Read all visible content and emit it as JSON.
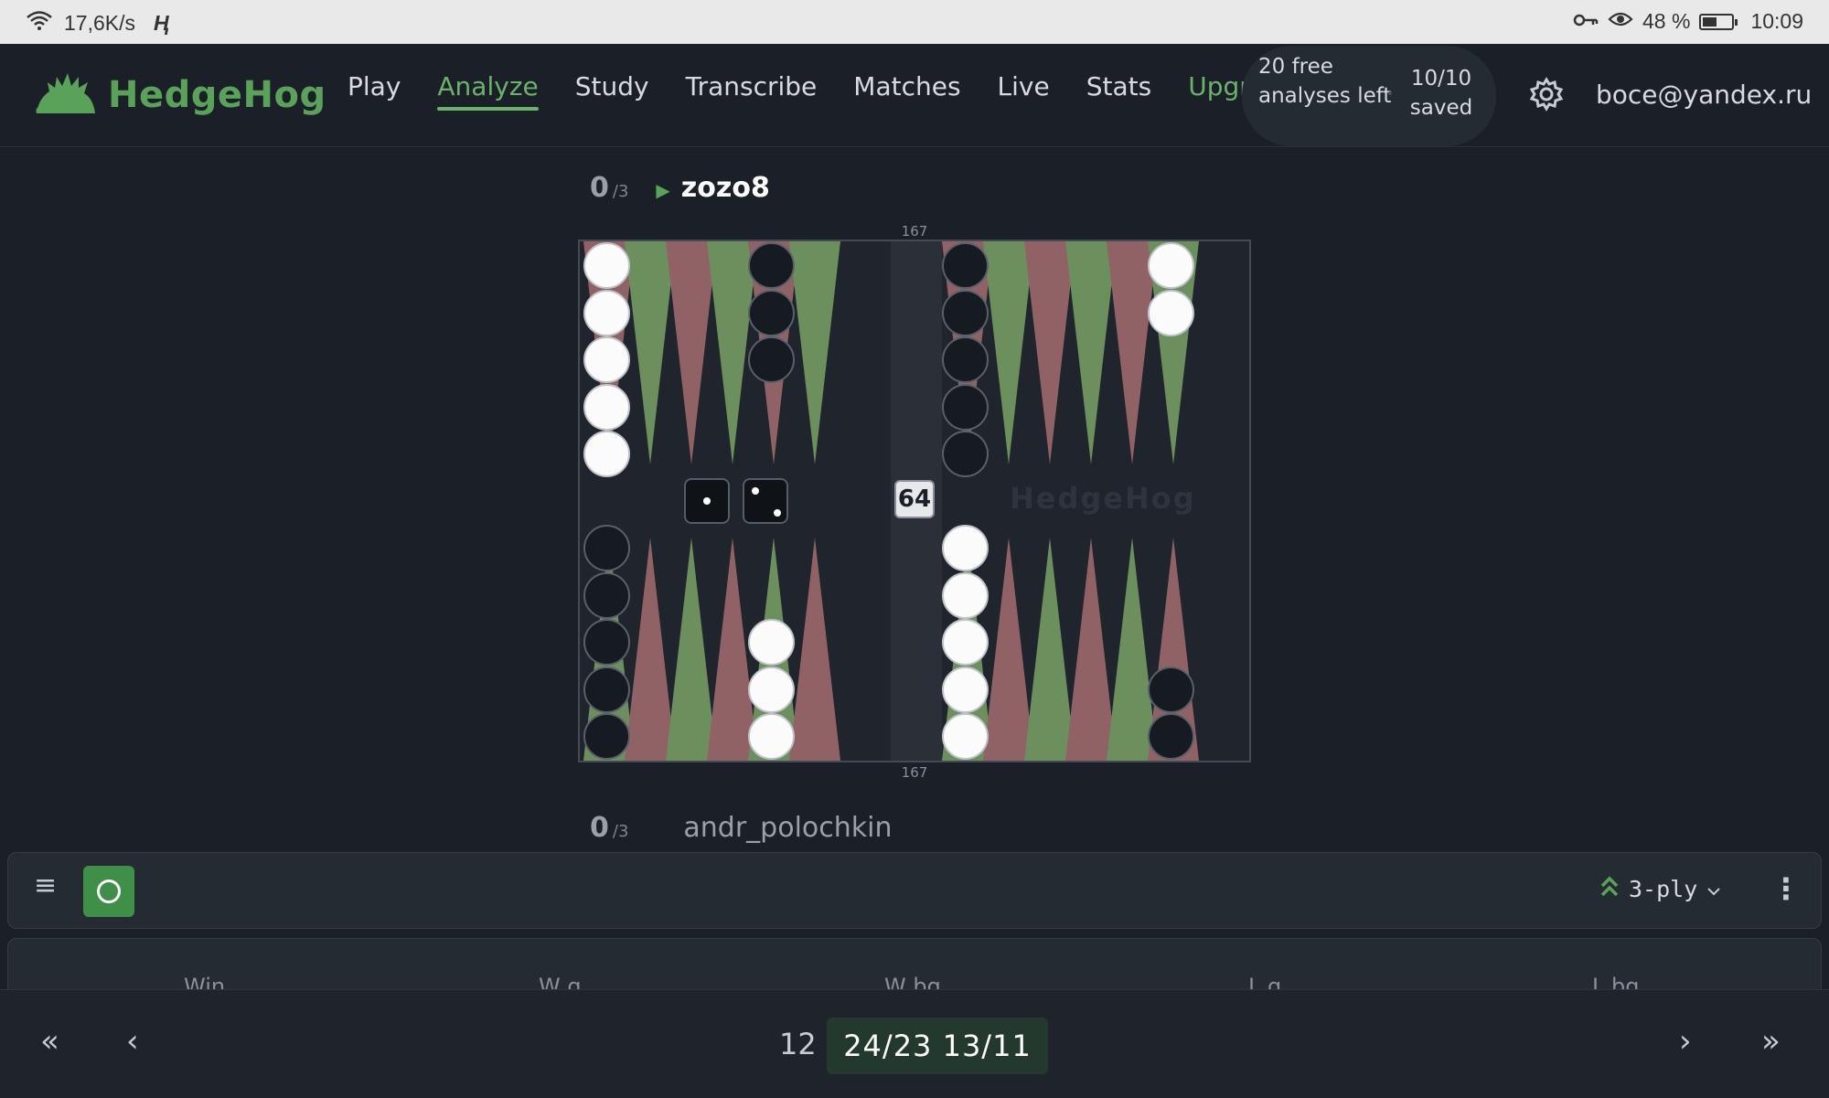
{
  "status_bar": {
    "network_speed": "17,6K/s",
    "battery": "48 %",
    "time": "10:09",
    "battery_level": 0.48
  },
  "header": {
    "logo": "HedgeHog",
    "nav": [
      "Play",
      "Analyze",
      "Study",
      "Transcribe",
      "Matches",
      "Live",
      "Stats",
      "Upgrade"
    ],
    "active_nav": "Analyze",
    "quota_free": "20 free analyses left",
    "quota_saved": "10/10 saved",
    "user_email": "boce@yandex.ru"
  },
  "match": {
    "top_player": {
      "score": "0",
      "score_max": "/3",
      "name": "zozo8"
    },
    "bottom_player": {
      "score": "0",
      "score_max": "/3",
      "name": "andr_polochkin"
    },
    "pip_top": "167",
    "pip_bottom": "167",
    "cube_value": "64",
    "dice": [
      1,
      2
    ],
    "watermark": "HedgeHog"
  },
  "toolbar": {
    "menu_icon": "≡",
    "ply_label": "3-ply"
  },
  "stats_headers": [
    "Win",
    "W g",
    "W bg",
    "L g",
    "L bg"
  ],
  "footer": {
    "move_number": "12",
    "move_text": "24/23 13/11"
  },
  "colors": {
    "accent_green": "#5aa25a",
    "point_green": "#6c8f5e",
    "point_red": "#906266",
    "background": "#1b1f27"
  }
}
